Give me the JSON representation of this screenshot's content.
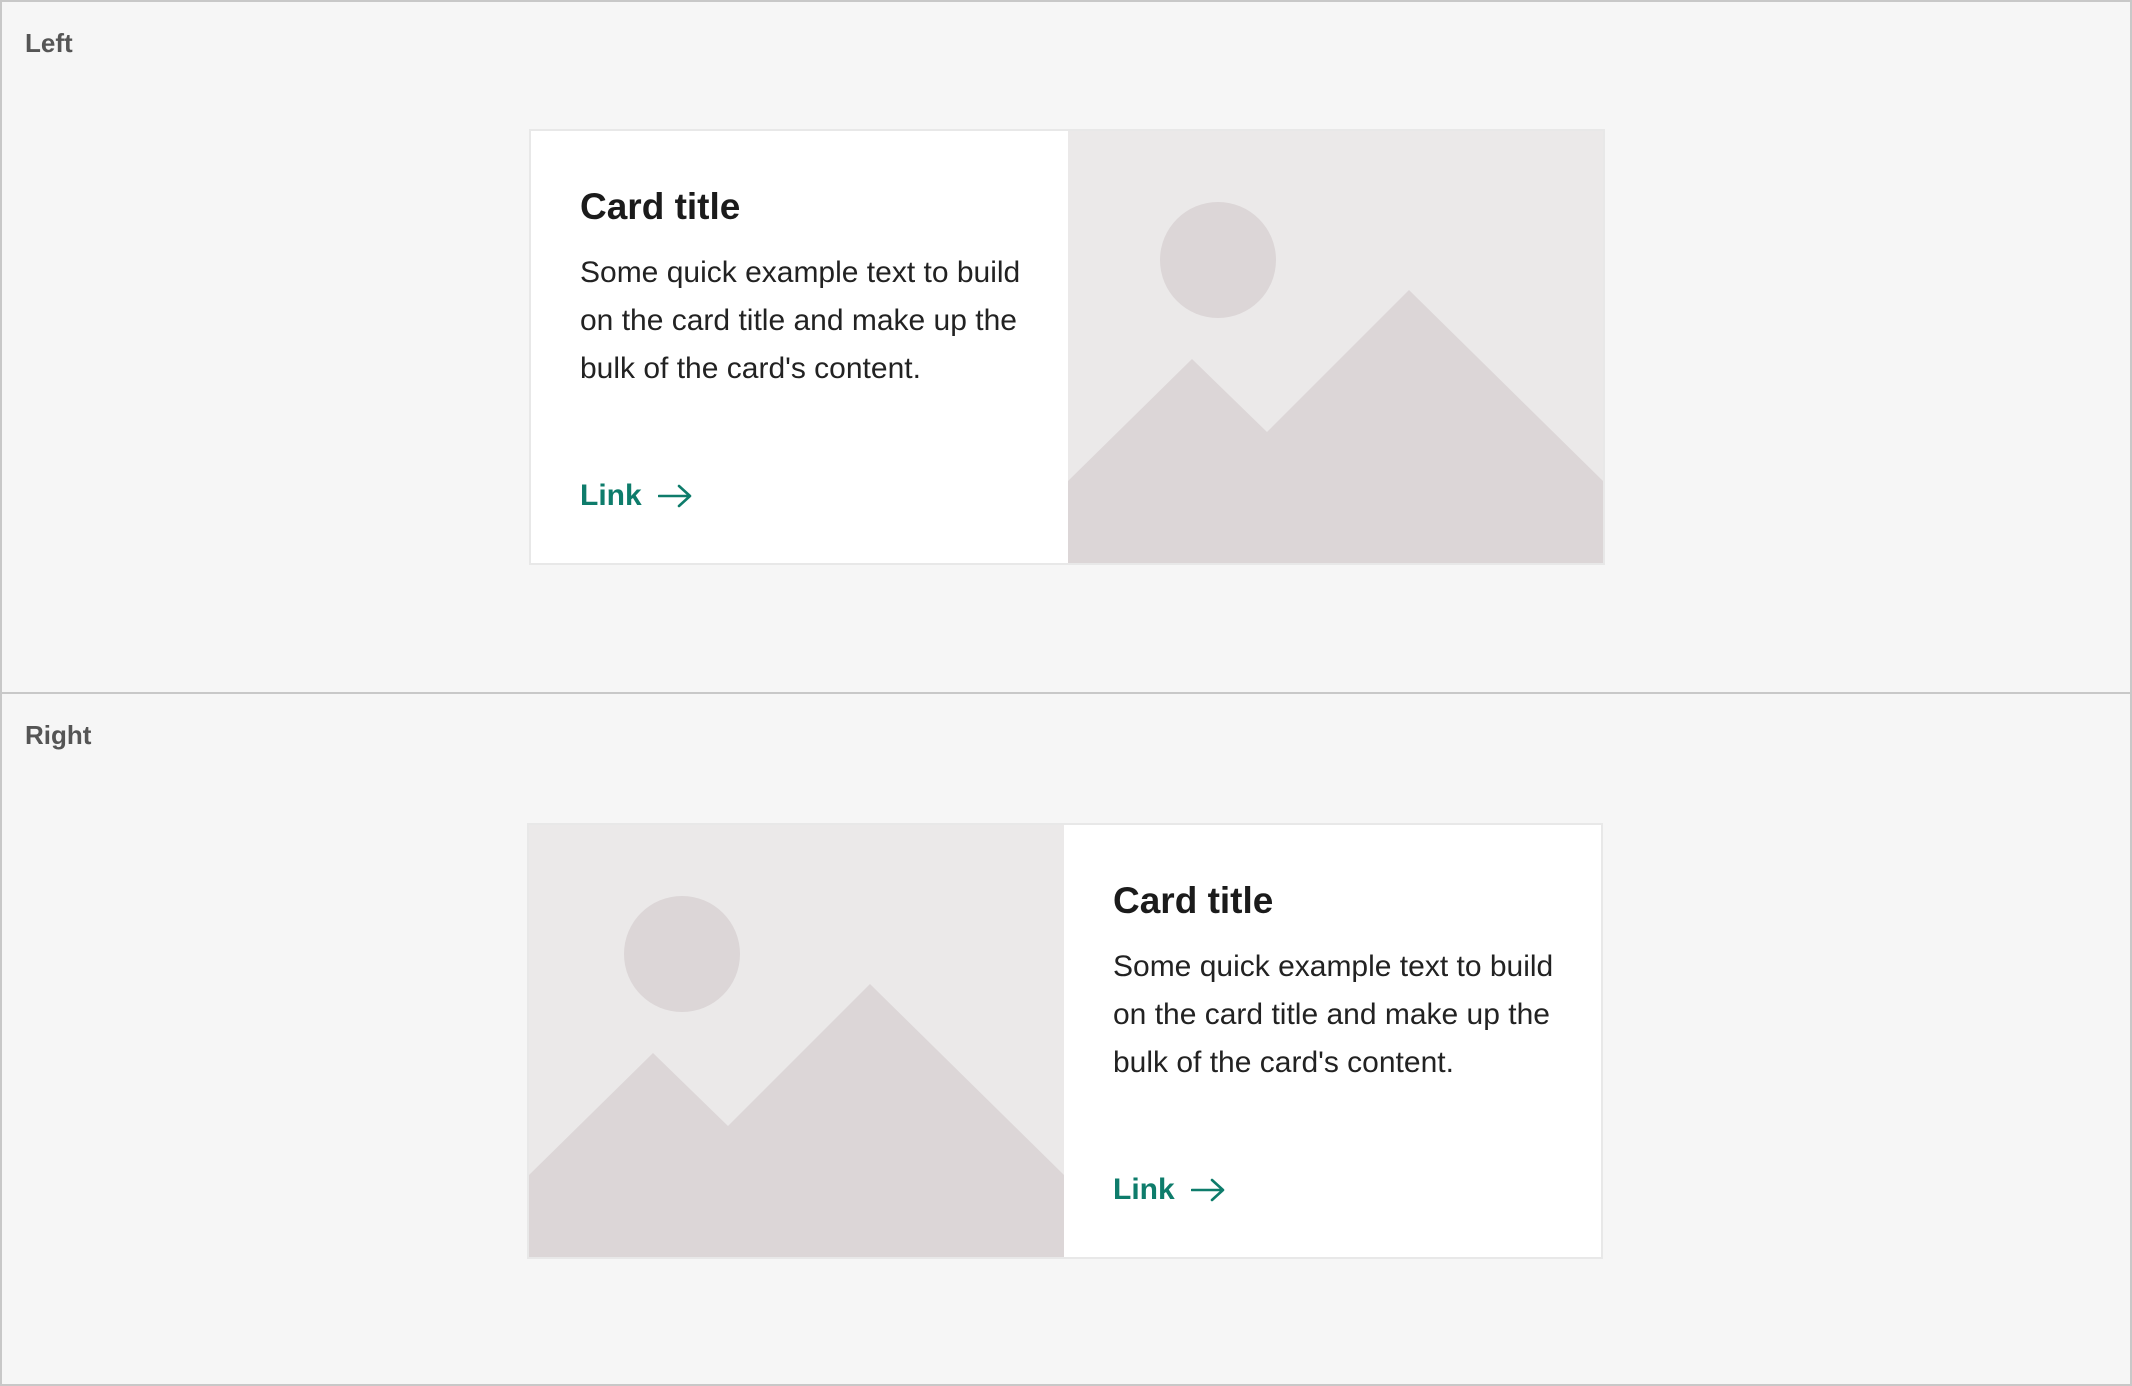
{
  "sections": [
    {
      "label": "Left",
      "card": {
        "title": "Card title",
        "text": "Some quick example text to build on the card title and make up the bulk of the card's content.",
        "link_label": "Link",
        "link_icon": "arrow-right-icon",
        "image_icon": "image-placeholder-icon"
      }
    },
    {
      "label": "Right",
      "card": {
        "title": "Card title",
        "text": "Some quick example text to build on the card title and make up the bulk of the card's content.",
        "link_label": "Link",
        "link_icon": "arrow-right-icon",
        "image_icon": "image-placeholder-icon"
      }
    }
  ],
  "colors": {
    "accent": "#0e7c6b",
    "placeholder_bg": "#ebe9e9",
    "placeholder_shape": "#dcd6d7",
    "section_bg": "#f6f6f6"
  }
}
